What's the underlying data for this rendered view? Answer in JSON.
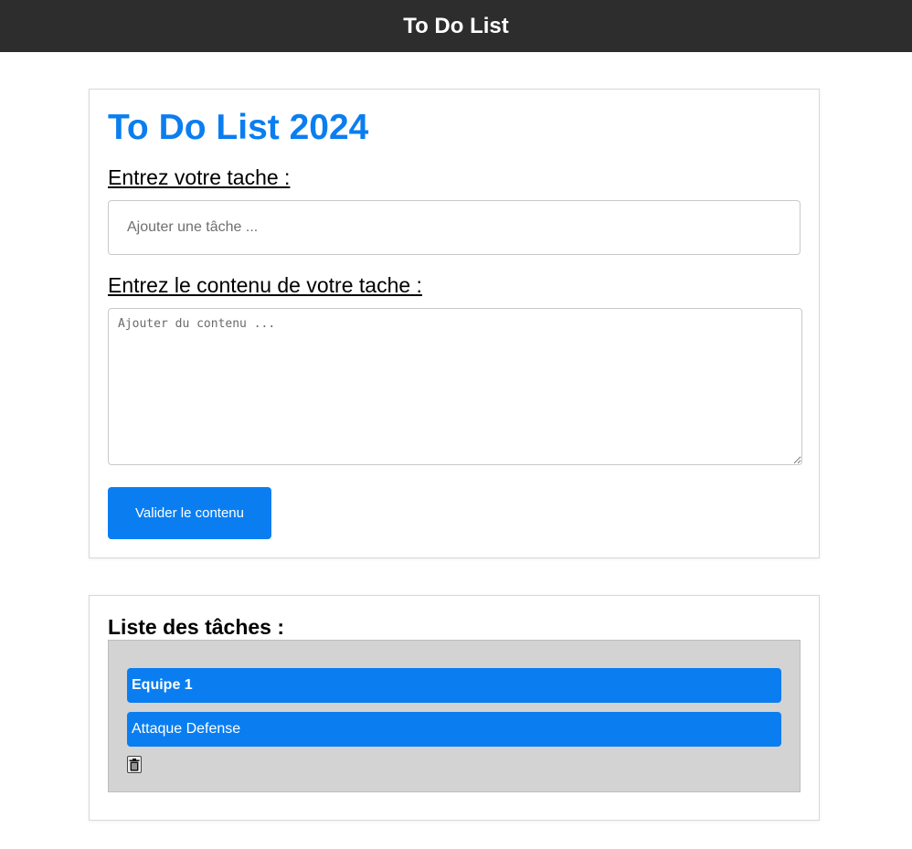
{
  "header": {
    "title": "To Do List"
  },
  "form": {
    "heading": "To Do List 2024",
    "task_label": "Entrez votre tache :",
    "task_placeholder": "Ajouter une tâche ...",
    "task_value": "",
    "content_label": "Entrez le contenu de votre tache :",
    "content_placeholder": "Ajouter du contenu ...",
    "content_value": "",
    "submit_label": "Valider le contenu"
  },
  "task_list": {
    "heading": "Liste des tâches :",
    "items": [
      {
        "name": "Equipe 1",
        "content": "Attaque Defense",
        "delete_icon": "trash-icon"
      }
    ]
  },
  "colors": {
    "header_bg": "#2d2d2d",
    "accent": "#0a7ef0",
    "panel_bg": "#d3d3d3"
  }
}
